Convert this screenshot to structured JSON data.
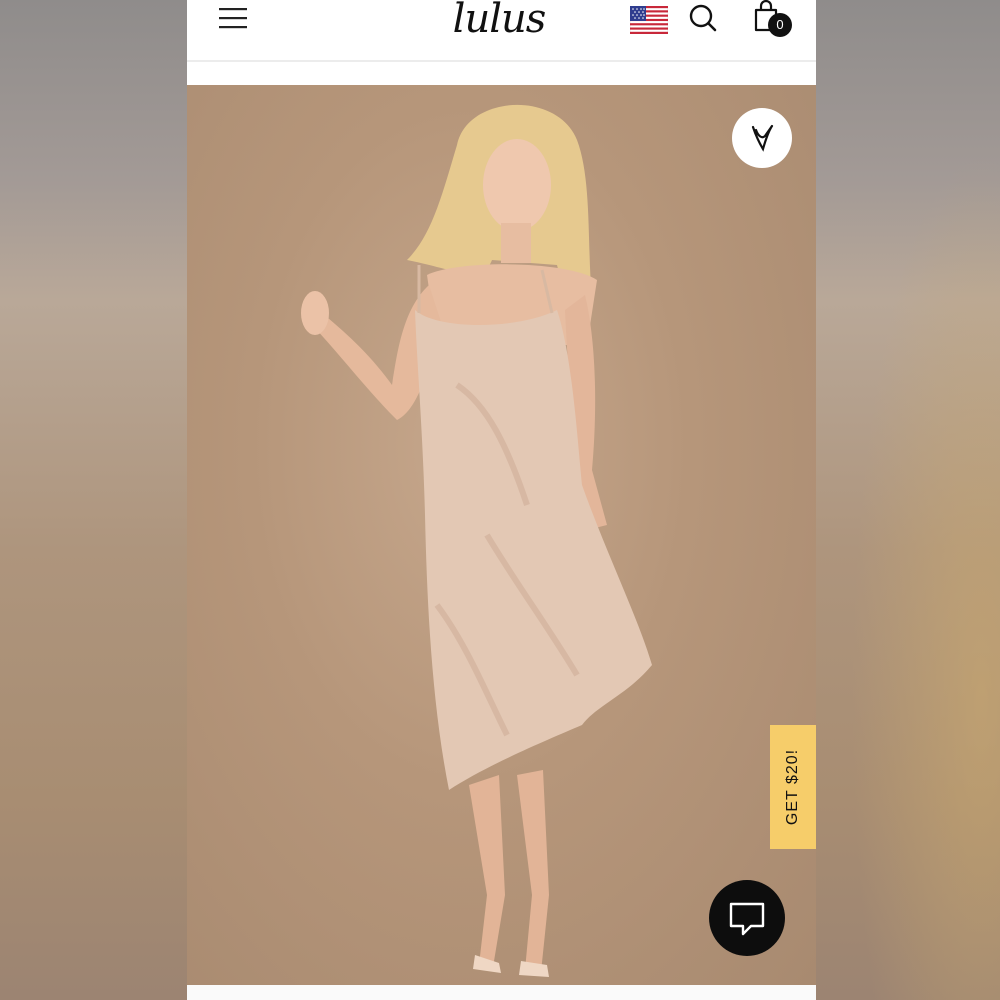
{
  "header": {
    "logo_text": "lulus",
    "icons": [
      "menu-icon",
      "us-flag-icon",
      "search-icon",
      "shopping-bag-icon"
    ],
    "cart_count": "0"
  },
  "product_image": {
    "wishlist_icon": "heart-icon"
  },
  "promo": {
    "label": "GET $20!"
  },
  "chat": {
    "icon": "chat-bubble-icon"
  },
  "colors": {
    "background_photo": "#b6967a",
    "promo_tab": "#f6cd6a",
    "chat_button": "#0d0d0d",
    "dress": "#e3c8b4"
  }
}
